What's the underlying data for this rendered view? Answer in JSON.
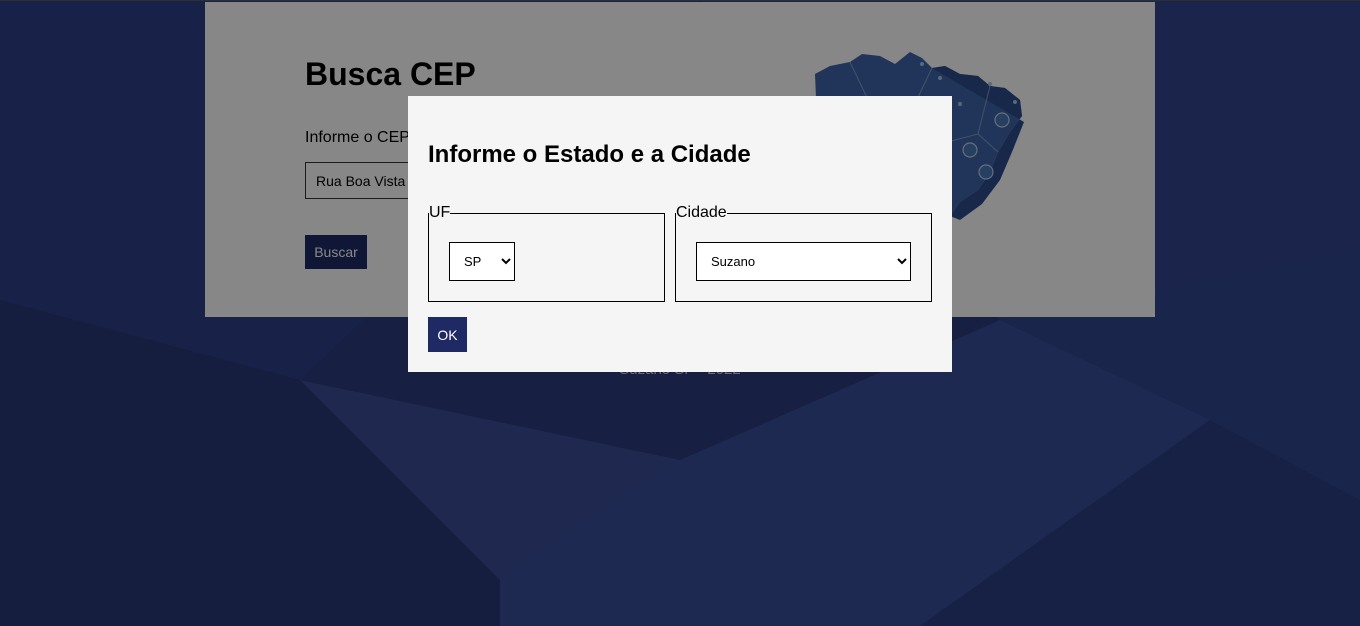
{
  "page": {
    "title": "Busca CEP",
    "cep_label": "Informe o CEP",
    "cep_value": "Rua Boa Vista",
    "search_button": "Buscar",
    "footer": "Suzano SP - 2022"
  },
  "modal": {
    "title": "Informe o Estado e a Cidade",
    "uf_legend": "UF",
    "uf_selected": "SP",
    "city_legend": "Cidade",
    "city_selected": "Suzano",
    "ok_button": "OK"
  },
  "icons": {
    "map": "brazil-map-icon"
  },
  "colors": {
    "accent": "#1f2a64",
    "background": "#2a3a78",
    "card": "#ffffff",
    "modal": "#f5f5f5"
  }
}
